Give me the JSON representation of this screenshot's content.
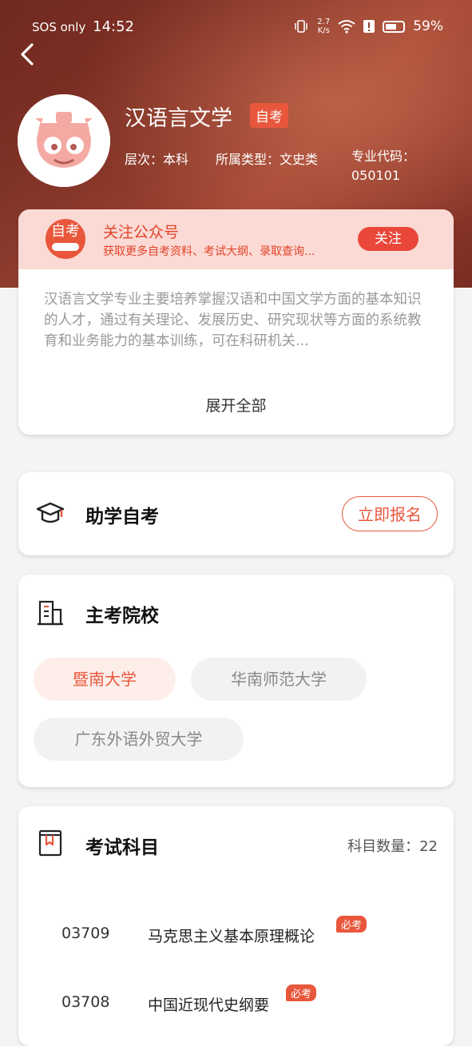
{
  "status_bar": {
    "carrier": "SOS only",
    "time": "14:52",
    "speed_value": "2.7",
    "speed_unit": "K/s",
    "battery": "59%"
  },
  "major": {
    "title": "汉语言文学",
    "tag": "自考",
    "level": "层次：本科",
    "category": "所属类型：文史类",
    "code_label": "专业代码：",
    "code": "050101"
  },
  "follow": {
    "logo_text": "自考",
    "title": "关注公众号",
    "subtitle": "获取更多自考资料、考试大纲、录取查询...",
    "button": "关注"
  },
  "description": {
    "text": "汉语言文学专业主要培养掌握汉语和中国文学方面的基本知识的人才，通过有关理论、发展历史、研究现状等方面的系统教育和业务能力的基本训练，可在科研机关...",
    "expand": "展开全部"
  },
  "signup": {
    "title": "助学自考",
    "button": "立即报名",
    "icon": "graduation-cap-icon"
  },
  "schools": {
    "title": "主考院校",
    "icon": "building-icon",
    "items": [
      "暨南大学",
      "华南师范大学",
      "广东外语外贸大学"
    ]
  },
  "exam": {
    "title": "考试科目",
    "icon": "book-icon",
    "count_label": "科目数量：22",
    "courses": [
      {
        "code": "03709",
        "name": "马克思主义基本原理概论",
        "badge": "必考"
      },
      {
        "code": "03708",
        "name": "中国近现代史纲要",
        "badge": "必考"
      }
    ]
  },
  "colors": {
    "accent": "#e8573c",
    "follow_bg": "#fbd9d4"
  }
}
